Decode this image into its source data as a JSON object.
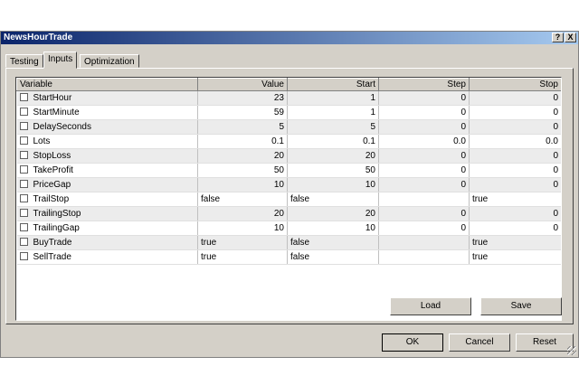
{
  "window": {
    "title": "NewsHourTrade"
  },
  "titlebar_buttons": {
    "help": "?",
    "close": "X"
  },
  "tabs": [
    {
      "label": "Testing"
    },
    {
      "label": "Inputs"
    },
    {
      "label": "Optimization"
    }
  ],
  "table": {
    "headers": [
      "Variable",
      "Value",
      "Start",
      "Step",
      "Stop"
    ],
    "rows": [
      {
        "name": "StartHour",
        "value": "23",
        "start": "1",
        "step": "0",
        "stop": "0"
      },
      {
        "name": "StartMinute",
        "value": "59",
        "start": "1",
        "step": "0",
        "stop": "0"
      },
      {
        "name": "DelaySeconds",
        "value": "5",
        "start": "5",
        "step": "0",
        "stop": "0"
      },
      {
        "name": "Lots",
        "value": "0.1",
        "start": "0.1",
        "step": "0.0",
        "stop": "0.0"
      },
      {
        "name": "StopLoss",
        "value": "20",
        "start": "20",
        "step": "0",
        "stop": "0"
      },
      {
        "name": "TakeProfit",
        "value": "50",
        "start": "50",
        "step": "0",
        "stop": "0"
      },
      {
        "name": "PriceGap",
        "value": "10",
        "start": "10",
        "step": "0",
        "stop": "0"
      },
      {
        "name": "TrailStop",
        "value": "false",
        "start": "false",
        "step": "",
        "stop": "true"
      },
      {
        "name": "TrailingStop",
        "value": "20",
        "start": "20",
        "step": "0",
        "stop": "0"
      },
      {
        "name": "TrailingGap",
        "value": "10",
        "start": "10",
        "step": "0",
        "stop": "0"
      },
      {
        "name": "BuyTrade",
        "value": "true",
        "start": "false",
        "step": "",
        "stop": "true"
      },
      {
        "name": "SellTrade",
        "value": "true",
        "start": "false",
        "step": "",
        "stop": "true"
      }
    ]
  },
  "panel_buttons": {
    "load": "Load",
    "save": "Save"
  },
  "dialog_buttons": {
    "ok": "OK",
    "cancel": "Cancel",
    "reset": "Reset"
  }
}
